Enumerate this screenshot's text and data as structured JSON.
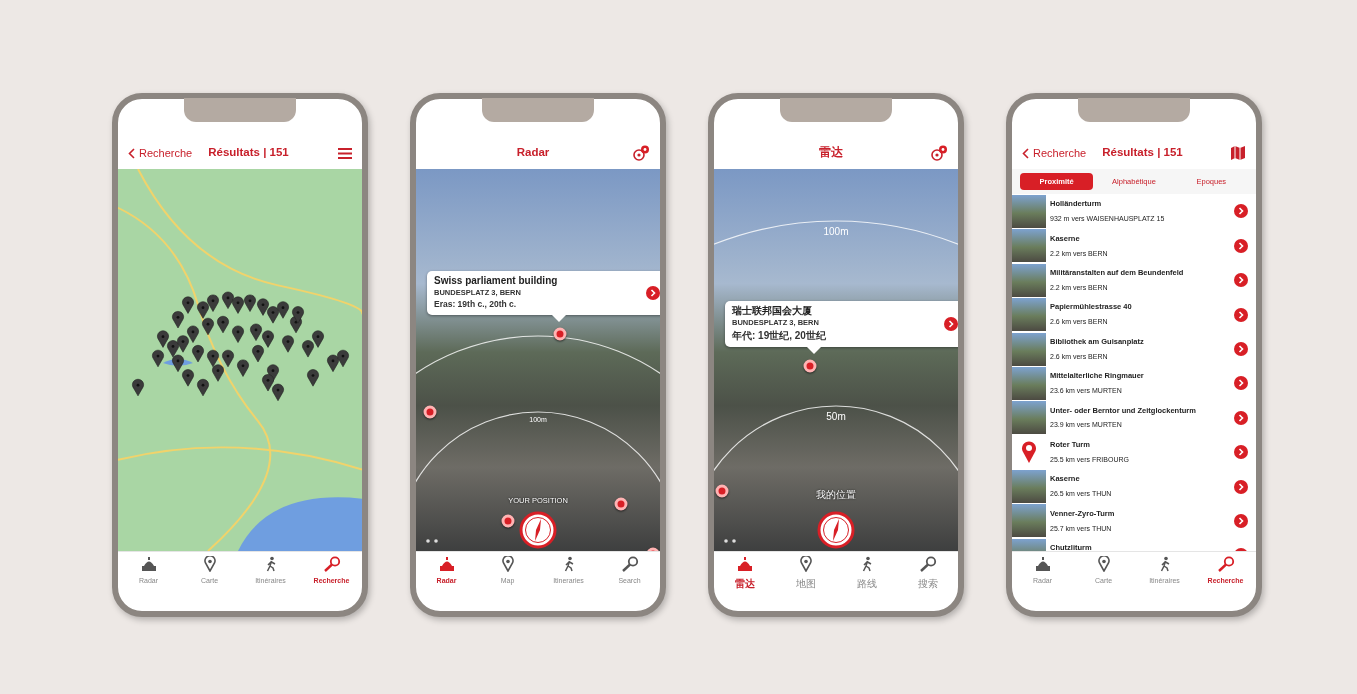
{
  "phones": [
    {
      "kind": "map",
      "header": {
        "back": "Recherche",
        "title": "Résultats | 151"
      },
      "nav": [
        {
          "label": "Radar",
          "selected": false
        },
        {
          "label": "Carte",
          "selected": false
        },
        {
          "label": "Itinéraires",
          "selected": false
        },
        {
          "label": "Recherche",
          "selected": true
        }
      ]
    },
    {
      "kind": "radar",
      "header": {
        "title": "Radar"
      },
      "callout": {
        "title": "Swiss parliament building",
        "address": "BUNDESPLATZ 3, BERN",
        "eras": "Eras: 19th c., 20th c."
      },
      "ring_labels": [
        {
          "kind": "inner",
          "text": "100m"
        }
      ],
      "position_label": "YOUR POSITION",
      "nav": [
        {
          "label": "Radar",
          "selected": true
        },
        {
          "label": "Map",
          "selected": false
        },
        {
          "label": "Itineraries",
          "selected": false
        },
        {
          "label": "Search",
          "selected": false
        }
      ]
    },
    {
      "kind": "radar",
      "header": {
        "title": "雷达"
      },
      "callout": {
        "title": "瑞士联邦国会大厦",
        "address": "BUNDESPLATZ 3, BERN",
        "eras": "年代: 19世纪, 20世纪"
      },
      "ring_labels": [
        {
          "kind": "outer",
          "text": "100m"
        },
        {
          "kind": "inner",
          "text": "50m"
        }
      ],
      "position_label": "我的位置",
      "nav": [
        {
          "label": "雷达",
          "selected": true
        },
        {
          "label": "地图",
          "selected": false
        },
        {
          "label": "路线",
          "selected": false
        },
        {
          "label": "搜索",
          "selected": false
        }
      ]
    },
    {
      "kind": "list",
      "header": {
        "back": "Recherche",
        "title": "Résultats | 151"
      },
      "segments": [
        {
          "label": "Proximité",
          "selected": true
        },
        {
          "label": "Alphabétique",
          "selected": false
        },
        {
          "label": "Epoques",
          "selected": false
        }
      ],
      "results": [
        {
          "name": "Holländerturm",
          "distance": "932 m vers WAISENHAUSPLATZ 15",
          "kind": "photo"
        },
        {
          "name": "Kaserne",
          "distance": "2.2 km vers BERN",
          "kind": "photo"
        },
        {
          "name": "Militäranstalten auf dem Beundenfeld",
          "distance": "2.2 km vers BERN",
          "kind": "photo"
        },
        {
          "name": "Papiermühlestrasse 40",
          "distance": "2.6 km vers BERN",
          "kind": "photo"
        },
        {
          "name": "Bibliothek am Guisanplatz",
          "distance": "2.6 km vers BERN",
          "kind": "photo"
        },
        {
          "name": "Mittelalterliche Ringmauer",
          "distance": "23.6 km vers MURTEN",
          "kind": "photo"
        },
        {
          "name": "Unter- oder Berntor und Zeitglockenturm",
          "distance": "23.9 km vers MURTEN",
          "kind": "photo"
        },
        {
          "name": "Roter Turm",
          "distance": "25.5 km vers FRIBOURG",
          "kind": "pin"
        },
        {
          "name": "Kaserne",
          "distance": "26.5 km vers THUN",
          "kind": "photo"
        },
        {
          "name": "Venner-Zyro-Turm",
          "distance": "25.7 km vers THUN",
          "kind": "photo"
        },
        {
          "name": "Chutzliturm",
          "kind": "photo"
        }
      ],
      "nav": [
        {
          "label": "Radar",
          "selected": false
        },
        {
          "label": "Carte",
          "selected": false
        },
        {
          "label": "Itinéraires",
          "selected": false
        },
        {
          "label": "Recherche",
          "selected": true
        }
      ]
    }
  ]
}
